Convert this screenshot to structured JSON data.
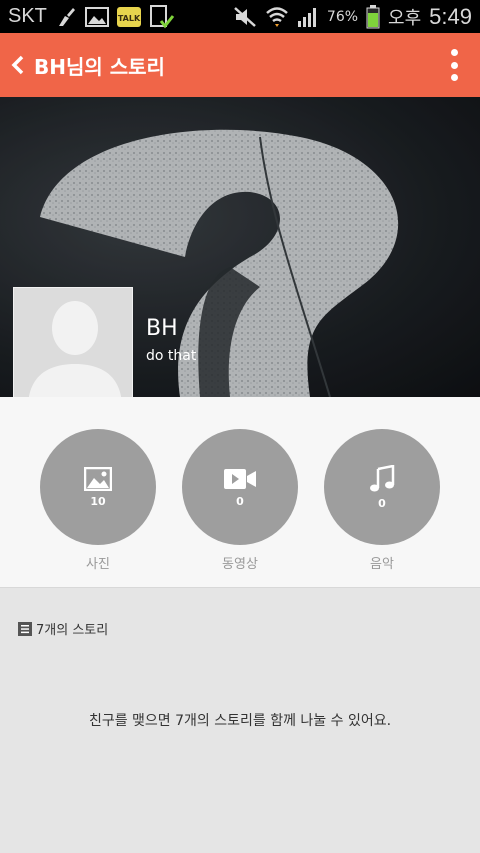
{
  "status_bar": {
    "carrier": "SKT",
    "battery_percent": "76%",
    "ampm": "오후",
    "time": "5:49",
    "icons": [
      "cleaner-icon",
      "gallery-icon",
      "kakaotalk-icon",
      "clipboard-check-icon",
      "mute-icon",
      "wifi-icon",
      "signal-icon",
      "battery-icon"
    ],
    "talk_label": "TALK"
  },
  "action_bar": {
    "title": "BH님의 스토리",
    "color": "#f06548"
  },
  "profile": {
    "name": "BH",
    "status": "do that"
  },
  "media": {
    "items": [
      {
        "icon": "photo-icon",
        "count": "10",
        "label": "사진"
      },
      {
        "icon": "video-icon",
        "count": "0",
        "label": "동영상"
      },
      {
        "icon": "music-icon",
        "count": "0",
        "label": "음악"
      }
    ]
  },
  "stories": {
    "count_label": "7개의 스토리",
    "empty_message": "친구를 맺으면 7개의 스토리를 함께 나눌 수 있어요."
  }
}
